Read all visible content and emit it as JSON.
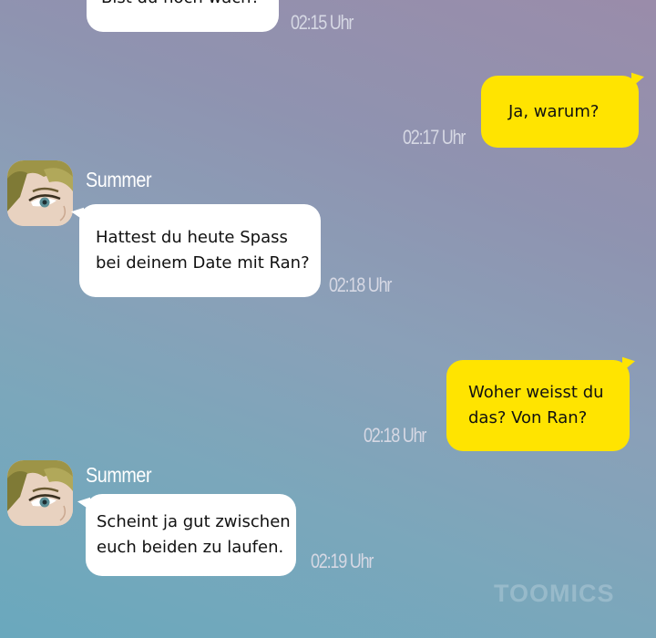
{
  "messages": [
    {
      "side": "incoming",
      "lines": [
        "Bist du noch wach?"
      ],
      "time": "02:15 Uhr"
    },
    {
      "side": "outgoing",
      "lines": [
        "Ja, warum?"
      ],
      "time": "02:17 Uhr"
    },
    {
      "side": "incoming",
      "sender": "Summer",
      "lines": [
        "Hattest du heute Spass",
        "bei deinem Date mit Ran?"
      ],
      "time": "02:18 Uhr"
    },
    {
      "side": "outgoing",
      "lines": [
        "Woher weisst du",
        "das? Von Ran?"
      ],
      "time": "02:18 Uhr"
    },
    {
      "side": "incoming",
      "sender": "Summer",
      "lines": [
        "Scheint ja gut zwischen",
        "euch beiden zu laufen."
      ],
      "time": "02:19 Uhr"
    }
  ],
  "watermark": "TOOMICS",
  "colors": {
    "incoming_bubble": "#ffffff",
    "outgoing_bubble": "#ffe400",
    "timestamp": "#d6d8e4",
    "sender_name": "#ffffff"
  },
  "icons": {
    "avatar": "summer-avatar-icon"
  }
}
